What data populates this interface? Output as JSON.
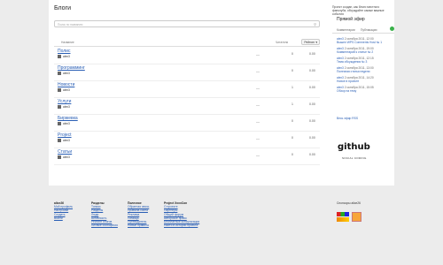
{
  "page": {
    "title": "Блоги"
  },
  "search": {
    "placeholder": "Поиск по названию"
  },
  "table": {
    "col_title": "Название",
    "col_readers": "Читатели",
    "col_rating": "Рейтинг ▾",
    "rows": [
      {
        "title": "Полис",
        "author": "alex3",
        "dash": "—",
        "readers": "0",
        "rating": "0.00"
      },
      {
        "title": "Программинг",
        "author": "alex3",
        "dash": "—",
        "readers": "0",
        "rating": "0.00"
      },
      {
        "title": "Новости",
        "author": "alex3",
        "dash": "—",
        "readers": "1",
        "rating": "0.00"
      },
      {
        "title": "Услуги",
        "author": "alex3",
        "dash": "—",
        "readers": "1",
        "rating": "0.00"
      },
      {
        "title": "Биржевка",
        "author": "alex3",
        "dash": "—",
        "readers": "0",
        "rating": "0.00"
      },
      {
        "title": "Project",
        "author": "alex3",
        "dash": "—",
        "readers": "0",
        "rating": "0.00"
      },
      {
        "title": "Статьи",
        "author": "alex3",
        "dash": "—",
        "readers": "0",
        "rating": "0.00"
      }
    ]
  },
  "sidebar": {
    "intro": "Проект создан, как блоги местного фанклуба, обсуждайте самые важные события",
    "live_title": "Прямой эфир",
    "tab_comments": "Комментарии",
    "tab_publications": "Публикации",
    "feed": [
      {
        "user": "alex3",
        "meta": "2 октября 2011, 12:00",
        "link": "Вышел WPS Comments Host № 1"
      },
      {
        "user": "alex3",
        "meta": "2 октября 2011, 19:00",
        "link": "Комментарий к статье № 2"
      },
      {
        "user": "alex3",
        "meta": "2 октября 2011, 12:15",
        "link": "Тема обсуждения № 3"
      },
      {
        "user": "alex3",
        "meta": "2 октября 2011, 13:00",
        "link": "Полезная статья недели"
      },
      {
        "user": "alex3",
        "meta": "2 октября 2011, 14:20",
        "link": "Новое в проекте"
      },
      {
        "user": "alex3",
        "meta": "2 октября 2011, 15:05",
        "link": "Обзор на тему"
      }
    ],
    "all_link": "Весь эфир  RSS",
    "github_title": "github",
    "github_sub": "SOCIAL CODING"
  },
  "footer": {
    "col1": {
      "head": "alice26",
      "links": [
        "Мой профиль",
        "Настройки",
        "Создать",
        "Выйти"
      ]
    },
    "col2": {
      "head": "Разделы",
      "links": [
        "Топики",
        "Разделы",
        "Люди",
        "Активность",
        "Рейтинг блогов",
        "Личные сообщения"
      ]
    },
    "col3": {
      "head": "Полезное",
      "links": [
        "Обратная связь",
        "Правила сайта",
        "Реклама",
        "Помощь",
        "Путеводитель",
        "Новые правила"
      ]
    },
    "col4": {
      "head": "Project XxxxCon",
      "links": [
        "О проекте",
        "Партнеры",
        "Общий форум",
        "Авторское право",
        "Бесплатные консультации",
        "Найти в истории проекта"
      ]
    },
    "support": "Спонсоры alice26"
  }
}
